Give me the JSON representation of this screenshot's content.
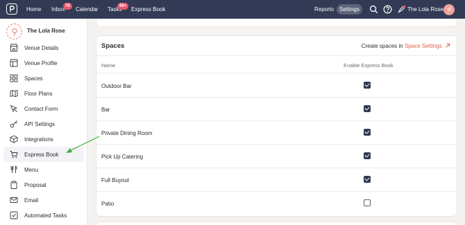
{
  "nav": {
    "home": "Home",
    "inbox": "Inbox",
    "inbox_badge": "79",
    "calendar": "Calendar",
    "tasks": "Tasks",
    "tasks_badge": "99+",
    "express_book": "Express Book",
    "reports": "Reports",
    "settings": "Settings",
    "user_name": "The Lola Rose",
    "avatar_letter": "d"
  },
  "sidebar": {
    "venue_name": "The Lola Rose",
    "items": [
      {
        "label": "Venue Details",
        "icon": "storefront-icon"
      },
      {
        "label": "Venue Profile",
        "icon": "layout-icon"
      },
      {
        "label": "Spaces",
        "icon": "grid-icon"
      },
      {
        "label": "Floor Plans",
        "icon": "map-icon"
      },
      {
        "label": "Contact Form",
        "icon": "cursor-icon"
      },
      {
        "label": "API Settings",
        "icon": "key-icon"
      },
      {
        "label": "Integrations",
        "icon": "cube-icon"
      },
      {
        "label": "Express Book",
        "icon": "cart-icon",
        "active": true
      },
      {
        "label": "Menu",
        "icon": "utensils-icon"
      },
      {
        "label": "Proposal",
        "icon": "clipboard-icon"
      },
      {
        "label": "Email",
        "icon": "mail-icon"
      },
      {
        "label": "Automated Tasks",
        "icon": "checkbox-icon"
      }
    ]
  },
  "spaces": {
    "title": "Spaces",
    "create_text": "Create spaces in",
    "link_text": "Space Settings",
    "col_name": "Name",
    "col_enable": "Enable Express Book",
    "rows": [
      {
        "name": "Outdoor Bar",
        "enabled": true
      },
      {
        "name": "Bar",
        "enabled": true
      },
      {
        "name": "Private Dining Room",
        "enabled": true
      },
      {
        "name": "Pick Up Catering",
        "enabled": true
      },
      {
        "name": "Full Buyout",
        "enabled": true
      },
      {
        "name": "Patio",
        "enabled": false
      }
    ]
  },
  "colors": {
    "nav_bg": "#323a55",
    "accent": "#e8604a",
    "badge": "#e8566e",
    "arrow": "#3cb43c"
  }
}
